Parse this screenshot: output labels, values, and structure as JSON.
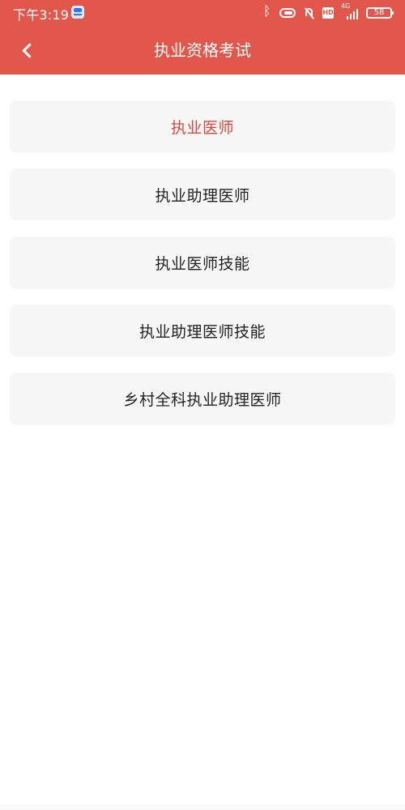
{
  "status_bar": {
    "time": "下午3:19",
    "app_icon": "app-notification-icon",
    "network_label": "4G",
    "hd_label": "HD",
    "battery": "58"
  },
  "header": {
    "back_icon": "chevron-left-icon",
    "title": "执业资格考试",
    "background_color": "#e2574b"
  },
  "options": [
    {
      "label": "执业医师",
      "selected": true,
      "color": "#d9473d"
    },
    {
      "label": "执业助理医师",
      "selected": false,
      "color": "#222222"
    },
    {
      "label": "执业医师技能",
      "selected": false,
      "color": "#222222"
    },
    {
      "label": "执业助理医师技能",
      "selected": false,
      "color": "#222222"
    },
    {
      "label": "乡村全科执业助理医师",
      "selected": false,
      "color": "#222222"
    }
  ]
}
